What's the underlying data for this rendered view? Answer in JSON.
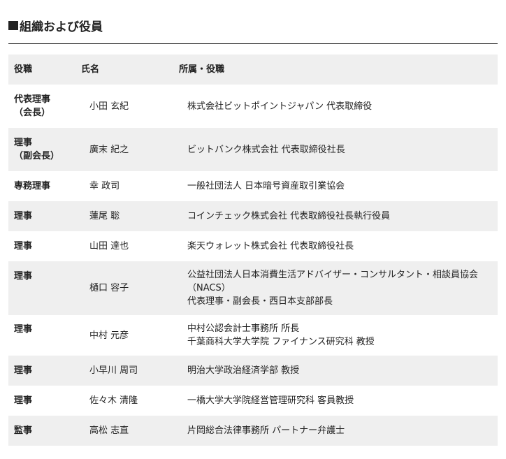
{
  "section": {
    "title": "組織および役員"
  },
  "table": {
    "headers": {
      "role": "役職",
      "name": "氏名",
      "affiliation": "所属・役職"
    },
    "rows": [
      {
        "role_lines": [
          "代表理事",
          "（会長）"
        ],
        "name": "小田 玄紀",
        "affiliation_lines": [
          "株式会社ビットポイントジャパン 代表取締役"
        ]
      },
      {
        "role_lines": [
          "理事",
          "（副会長）"
        ],
        "name": "廣末 紀之",
        "affiliation_lines": [
          "ビットバンク株式会社 代表取締役社長"
        ]
      },
      {
        "role_lines": [
          "専務理事"
        ],
        "name": "幸 政司",
        "affiliation_lines": [
          "一般社団法人 日本暗号資産取引業協会"
        ]
      },
      {
        "role_lines": [
          "理事"
        ],
        "name": "蓮尾 聡",
        "affiliation_lines": [
          "コインチェック株式会社 代表取締役社長執行役員"
        ]
      },
      {
        "role_lines": [
          "理事"
        ],
        "name": "山田 達也",
        "affiliation_lines": [
          "楽天ウォレット株式会社 代表取締役社長"
        ]
      },
      {
        "role_lines": [
          "理事"
        ],
        "name": "樋口 容子",
        "affiliation_lines": [
          "公益社団法人日本消費生活アドバイザー・コンサルタント・相談員協会",
          "（NACS）",
          "代表理事・副会長・西日本支部部長"
        ]
      },
      {
        "role_lines": [
          "理事"
        ],
        "name": "中村 元彦",
        "affiliation_lines": [
          "中村公認会計士事務所 所長",
          "千葉商科大学大学院 ファイナンス研究科 教授"
        ]
      },
      {
        "role_lines": [
          "理事"
        ],
        "name": "小早川 周司",
        "affiliation_lines": [
          "明治大学政治経済学部 教授"
        ]
      },
      {
        "role_lines": [
          "理事"
        ],
        "name": "佐々木 清隆",
        "affiliation_lines": [
          "一橋大学大学院経営管理研究科 客員教授"
        ]
      },
      {
        "role_lines": [
          "監事"
        ],
        "name": "高松 志直",
        "affiliation_lines": [
          "片岡総合法律事務所 パートナー弁護士"
        ]
      }
    ]
  },
  "colors": {
    "row_shade": "#efefef",
    "text": "#222222",
    "rule": "#333333"
  }
}
